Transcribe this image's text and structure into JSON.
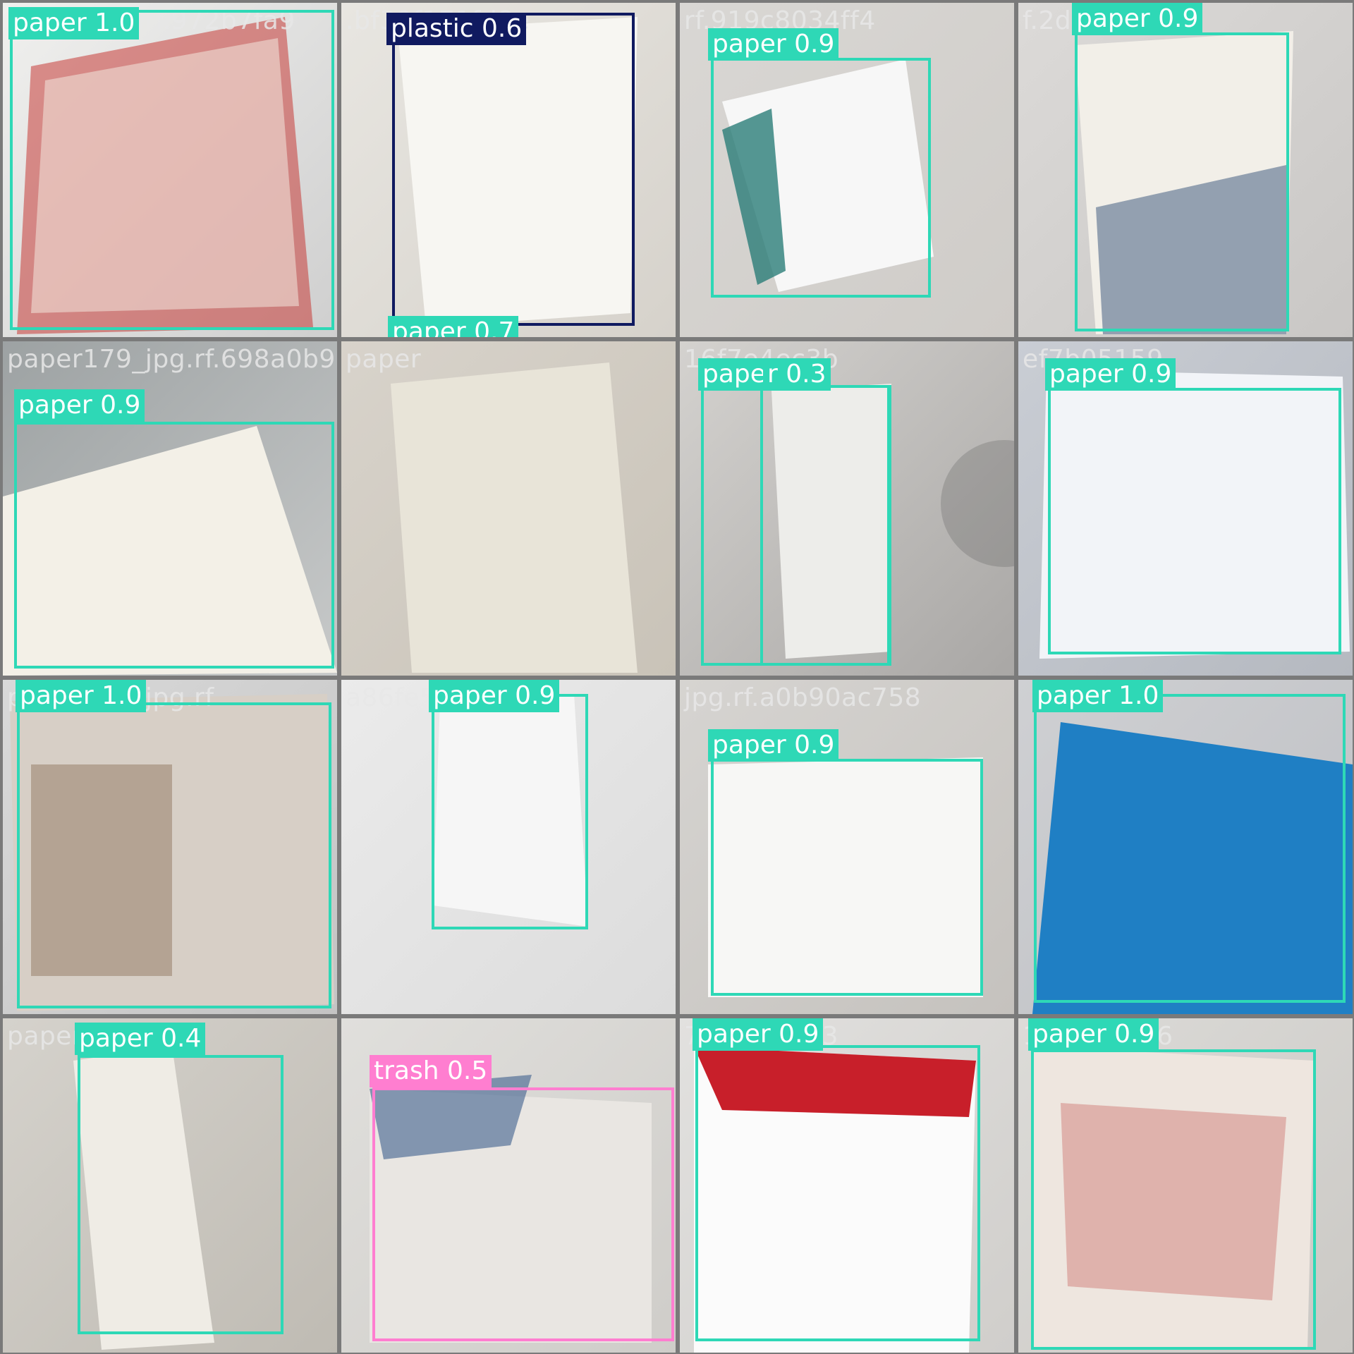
{
  "colors": {
    "paper": "#2ed8b6",
    "plastic": "#101a60",
    "trash": "#ff7ed0",
    "frame": "#7a7a7a"
  },
  "tiles": [
    {
      "name": "paper-tile-1",
      "filename": "paper_jpg.rf.972b7fa9",
      "detections": [
        {
          "cls": "paper",
          "text": "paper 1.0"
        }
      ]
    },
    {
      "name": "paper-tile-2",
      "filename": ".bf39f171fd8e",
      "detections": [
        {
          "cls": "plastic",
          "text": "plastic 0.6"
        },
        {
          "cls": "paper",
          "text": "paper 0.7"
        }
      ]
    },
    {
      "name": "paper-tile-3",
      "filename": "rf.919c8034ff4",
      "detections": [
        {
          "cls": "paper",
          "text": "paper 0.9"
        }
      ]
    },
    {
      "name": "paper-tile-4",
      "filename": "f.2d229e6505",
      "detections": [
        {
          "cls": "paper",
          "text": "paper 0.9"
        }
      ]
    },
    {
      "name": "paper-tile-5",
      "filename": "paper179_jpg.rf.698a0b9704",
      "detections": [
        {
          "cls": "paper",
          "text": "paper 0.9"
        }
      ]
    },
    {
      "name": "paper-tile-6",
      "filename": "paper",
      "detections": []
    },
    {
      "name": "paper-tile-7",
      "filename": "16f7e4ec3b",
      "detections": [
        {
          "cls": "paper",
          "text": "paper 0.3"
        },
        {
          "cls": "paper",
          "text": "r 0.3"
        }
      ]
    },
    {
      "name": "paper-tile-8",
      "filename": "ef7b05159",
      "detections": [
        {
          "cls": "paper",
          "text": "paper 0.9"
        }
      ]
    },
    {
      "name": "paper-tile-9",
      "filename": "paper174_jpg.rf",
      "detections": [
        {
          "cls": "paper",
          "text": "paper 1.0"
        }
      ]
    },
    {
      "name": "paper-tile-10",
      "filename": "a86fe5519d",
      "detections": [
        {
          "cls": "paper",
          "text": "paper 0.9"
        }
      ]
    },
    {
      "name": "paper-tile-11",
      "filename": "jpg.rf.a0b90ac758",
      "detections": [
        {
          "cls": "paper",
          "text": "paper 0.9"
        }
      ]
    },
    {
      "name": "paper-tile-12",
      "filename": "",
      "detections": [
        {
          "cls": "paper",
          "text": "paper 1.0"
        }
      ]
    },
    {
      "name": "paper-tile-13",
      "filename": "paper",
      "detections": [
        {
          "cls": "paper",
          "text": "paper 0.4"
        }
      ]
    },
    {
      "name": "paper-tile-14",
      "filename": "",
      "detections": [
        {
          "cls": "trash",
          "text": "trash 0.5"
        }
      ]
    },
    {
      "name": "paper-tile-15",
      "filename": "7f8ac1a553",
      "detections": [
        {
          "cls": "paper",
          "text": "paper 0.9"
        }
      ]
    },
    {
      "name": "paper-tile-16",
      "filename": "15f263f936",
      "detections": [
        {
          "cls": "paper",
          "text": "paper 0.9"
        }
      ]
    }
  ]
}
